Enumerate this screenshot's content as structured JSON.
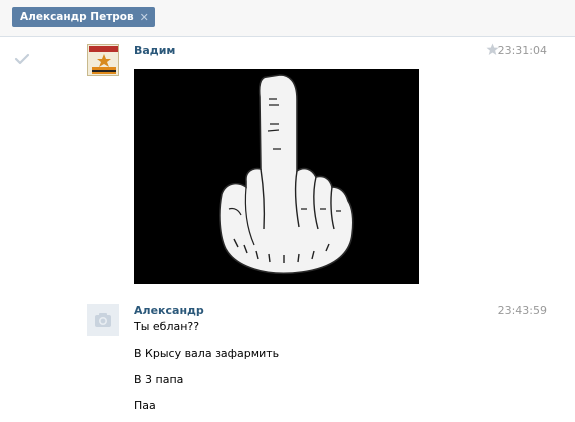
{
  "header": {
    "chip_label": "Александр Петров",
    "chip_close": "✕"
  },
  "messages": [
    {
      "author": "Вадим",
      "time": "23:31:04",
      "avatar_icon": "veterans-emblem-avatar",
      "attachment": "photo-middle-finger-hand",
      "starred": false,
      "read": true
    },
    {
      "author": "Александр",
      "time": "23:43:59",
      "avatar_icon": "camera-placeholder-icon",
      "lines": [
        "Ты еблан??",
        "В Крысу вала зафармить",
        "В 3 папа",
        "Паа"
      ]
    }
  ],
  "colors": {
    "chip_bg": "#5b7fa6",
    "author": "#2b587a",
    "time": "#999999",
    "topbar_bg": "#f7f7f7"
  }
}
